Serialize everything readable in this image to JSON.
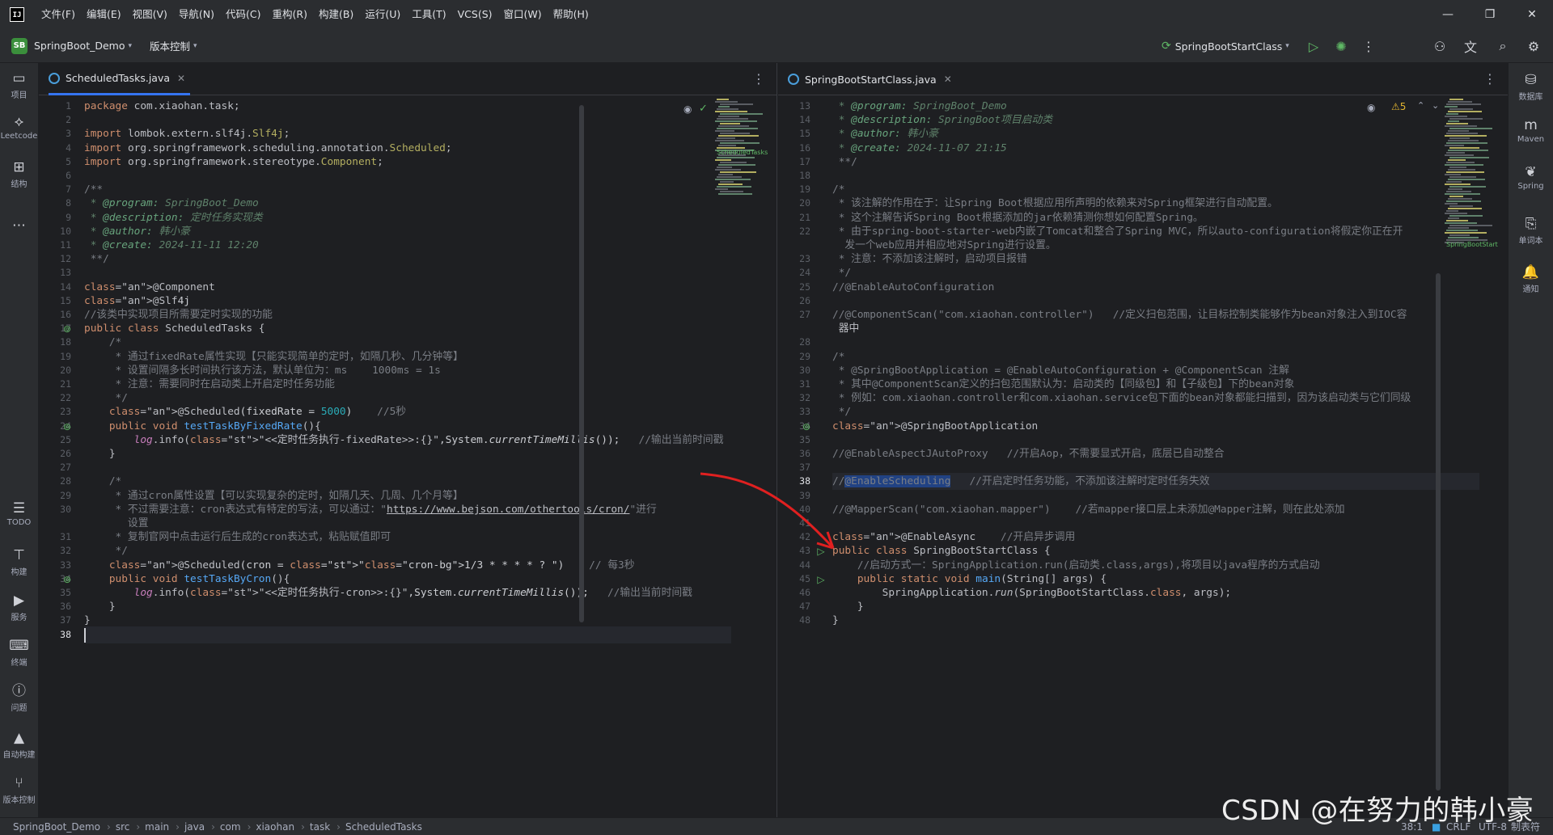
{
  "window": {
    "menu": [
      "文件(F)",
      "编辑(E)",
      "视图(V)",
      "导航(N)",
      "代码(C)",
      "重构(R)",
      "构建(B)",
      "运行(U)",
      "工具(T)",
      "VCS(S)",
      "窗口(W)",
      "帮助(H)"
    ],
    "controls": {
      "minimize": "—",
      "restore": "❐",
      "close": "✕"
    }
  },
  "toolbar": {
    "project_badge": "SB",
    "project_name": "SpringBoot_Demo",
    "vcs_label": "版本控制",
    "run_config": "SpringBootStartClass"
  },
  "left_strip": {
    "top": [
      {
        "icon": "folder-icon",
        "label": "项目"
      },
      {
        "icon": "leetcode-icon",
        "label": "Leetcode"
      },
      {
        "icon": "structure-icon",
        "label": "结构"
      },
      {
        "icon": "more-icon",
        "label": ""
      }
    ],
    "bottom": [
      {
        "icon": "todo-icon",
        "label": "TODO"
      },
      {
        "icon": "build-icon",
        "label": "构建"
      },
      {
        "icon": "services-icon",
        "label": "服务"
      },
      {
        "icon": "terminal-icon",
        "label": "终端"
      },
      {
        "icon": "problems-icon",
        "label": "问题"
      },
      {
        "icon": "auto-build-icon",
        "label": "自动构建"
      },
      {
        "icon": "vcs-icon",
        "label": "版本控制"
      }
    ]
  },
  "right_strip": [
    {
      "icon": "database-icon",
      "label": "数据库"
    },
    {
      "icon": "maven-icon",
      "label": "Maven"
    },
    {
      "icon": "spring-icon",
      "label": "Spring"
    },
    {
      "icon": "test-icon",
      "label": "单词本"
    },
    {
      "icon": "bell-icon",
      "label": "通知"
    }
  ],
  "left_editor": {
    "tab": "ScheduledTasks.java",
    "minimap_label": "ScheduledTasks",
    "lines": [
      {
        "n": "1",
        "t": "package com.xiaohan.task;"
      },
      {
        "n": "2",
        "t": ""
      },
      {
        "n": "3",
        "t": "import lombok.extern.slf4j.Slf4j;"
      },
      {
        "n": "4",
        "t": "import org.springframework.scheduling.annotation.Scheduled;"
      },
      {
        "n": "5",
        "t": "import org.springframework.stereotype.Component;"
      },
      {
        "n": "6",
        "t": ""
      },
      {
        "n": "7",
        "t": "/**"
      },
      {
        "n": "8",
        "t": " * @program: SpringBoot_Demo"
      },
      {
        "n": "9",
        "t": " * @description: 定时任务实现类"
      },
      {
        "n": "10",
        "t": " * @author: 韩小豪"
      },
      {
        "n": "11",
        "t": " * @create: 2024-11-11 12:20"
      },
      {
        "n": "12",
        "t": " **/"
      },
      {
        "n": "13",
        "t": ""
      },
      {
        "n": "14",
        "t": "@Component"
      },
      {
        "n": "15",
        "t": "@Slf4j"
      },
      {
        "n": "16",
        "t": "//该类中实现项目所需要定时实现的功能"
      },
      {
        "n": "17",
        "t": "public class ScheduledTasks {"
      },
      {
        "n": "18",
        "t": "    /*"
      },
      {
        "n": "19",
        "t": "     * 通过fixedRate属性实现【只能实现简单的定时，如隔几秒、几分钟等】"
      },
      {
        "n": "20",
        "t": "     * 设置间隔多长时间执行该方法，默认单位为：ms    1000ms = 1s"
      },
      {
        "n": "21",
        "t": "     * 注意：需要同时在启动类上开启定时任务功能"
      },
      {
        "n": "22",
        "t": "     */"
      },
      {
        "n": "23",
        "t": "    @Scheduled(fixedRate = 5000)    //5秒"
      },
      {
        "n": "24",
        "t": "    public void testTaskByFixedRate(){"
      },
      {
        "n": "25",
        "t": "        log.info(\"<<定时任务执行-fixedRate>>:{}\",System.currentTimeMillis());   //输出当前时间戳"
      },
      {
        "n": "26",
        "t": "    }"
      },
      {
        "n": "27",
        "t": ""
      },
      {
        "n": "28",
        "t": "    /*"
      },
      {
        "n": "29",
        "t": "     * 通过cron属性设置【可以实现复杂的定时，如隔几天、几周、几个月等】"
      },
      {
        "n": "30",
        "t": "     * 不过需要注意：cron表达式有特定的写法，可以通过：\"https://www.bejson.com/othertools/cron/\"进行"
      },
      {
        "n": "",
        "t": "       设置"
      },
      {
        "n": "31",
        "t": "     * 复制官网中点击运行后生成的cron表达式，粘贴赋值即可"
      },
      {
        "n": "32",
        "t": "     */"
      },
      {
        "n": "33",
        "t": "    @Scheduled(cron = \"1/3 * * * * ? \")    // 每3秒"
      },
      {
        "n": "34",
        "t": "    public void testTaskByCron(){"
      },
      {
        "n": "35",
        "t": "        log.info(\"<<定时任务执行-cron>>:{}\",System.currentTimeMillis());   //输出当前时间戳"
      },
      {
        "n": "36",
        "t": "    }"
      },
      {
        "n": "37",
        "t": "}"
      },
      {
        "n": "38",
        "t": ""
      }
    ]
  },
  "right_editor": {
    "tab": "SpringBootStartClass.java",
    "warnings": "5",
    "minimap_label": "SpringBootStart",
    "lines": [
      {
        "n": "13",
        "t": " * @program: SpringBoot_Demo"
      },
      {
        "n": "14",
        "t": " * @description: SpringBoot项目启动类"
      },
      {
        "n": "15",
        "t": " * @author: 韩小豪"
      },
      {
        "n": "16",
        "t": " * @create: 2024-11-07 21:15"
      },
      {
        "n": "17",
        "t": " **/"
      },
      {
        "n": "18",
        "t": ""
      },
      {
        "n": "19",
        "t": "/*"
      },
      {
        "n": "20",
        "t": " * 该注解的作用在于：让Spring Boot根据应用所声明的依赖来对Spring框架进行自动配置。"
      },
      {
        "n": "21",
        "t": " * 这个注解告诉Spring Boot根据添加的jar依赖猜测你想如何配置Spring。"
      },
      {
        "n": "22",
        "t": " * 由于spring-boot-starter-web内嵌了Tomcat和整合了Spring MVC，所以auto-configuration将假定你正在开"
      },
      {
        "n": "",
        "t": "  发一个web应用并相应地对Spring进行设置。"
      },
      {
        "n": "23",
        "t": " * 注意：不添加该注解时，启动项目报错"
      },
      {
        "n": "24",
        "t": " */"
      },
      {
        "n": "25",
        "t": "//@EnableAutoConfiguration"
      },
      {
        "n": "26",
        "t": ""
      },
      {
        "n": "27",
        "t": "//@ComponentScan(\"com.xiaohan.controller\")   //定义扫包范围，让目标控制类能够作为bean对象注入到IOC容"
      },
      {
        "n": "",
        "t": " 器中"
      },
      {
        "n": "28",
        "t": ""
      },
      {
        "n": "29",
        "t": "/*"
      },
      {
        "n": "30",
        "t": " * @SpringBootApplication = @EnableAutoConfiguration + @ComponentScan 注解"
      },
      {
        "n": "31",
        "t": " * 其中@ComponentScan定义的扫包范围默认为：启动类的【同级包】和【子级包】下的bean对象"
      },
      {
        "n": "32",
        "t": " * 例如：com.xiaohan.controller和com.xiaohan.service包下面的bean对象都能扫描到，因为该启动类与它们同级"
      },
      {
        "n": "33",
        "t": " */"
      },
      {
        "n": "34",
        "t": "@SpringBootApplication"
      },
      {
        "n": "35",
        "t": ""
      },
      {
        "n": "36",
        "t": "//@EnableAspectJAutoProxy   //开启Aop，不需要显式开启，底层已自动整合"
      },
      {
        "n": "37",
        "t": ""
      },
      {
        "n": "38",
        "t": "//@EnableScheduling   //开启定时任务功能，不添加该注解时定时任务失效"
      },
      {
        "n": "39",
        "t": ""
      },
      {
        "n": "40",
        "t": "//@MapperScan(\"com.xiaohan.mapper\")    //若mapper接口层上未添加@Mapper注解，则在此处添加"
      },
      {
        "n": "41",
        "t": ""
      },
      {
        "n": "42",
        "t": "@EnableAsync    //开启异步调用"
      },
      {
        "n": "43",
        "t": "public class SpringBootStartClass {"
      },
      {
        "n": "44",
        "t": "    //启动方式一：SpringApplication.run(启动类.class,args),将项目以java程序的方式启动"
      },
      {
        "n": "45",
        "t": "    public static void main(String[] args) {"
      },
      {
        "n": "46",
        "t": "        SpringApplication.run(SpringBootStartClass.class, args);"
      },
      {
        "n": "47",
        "t": "    }"
      },
      {
        "n": "48",
        "t": "}"
      }
    ]
  },
  "statusbar": {
    "breadcrumbs": [
      "SpringBoot_Demo",
      "src",
      "main",
      "java",
      "com",
      "xiaohan",
      "task",
      "ScheduledTasks"
    ],
    "position": "38:1",
    "line_sep": "CRLF",
    "encoding": "UTF-8",
    "indent": "制表符"
  },
  "watermark": "CSDN @在努力的韩小豪",
  "colors": {
    "accent": "#3574f0",
    "arrow": "#e02020",
    "keyword": "#cf8e6d",
    "annotation": "#b3ae60",
    "string": "#6aab73"
  }
}
